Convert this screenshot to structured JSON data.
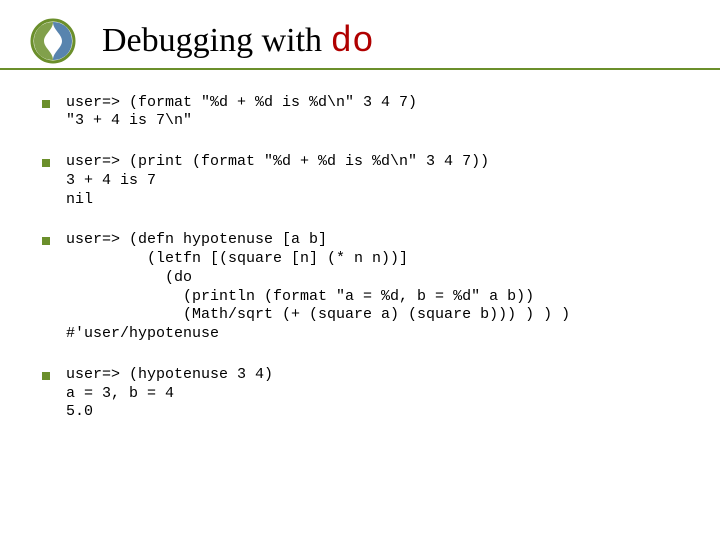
{
  "title_prefix": "Debugging with ",
  "title_keyword": "do",
  "bullets": [
    "user=> (format \"%d + %d is %d\\n\" 3 4 7)\n\"3 + 4 is 7\\n\"",
    "user=> (print (format \"%d + %d is %d\\n\" 3 4 7))\n3 + 4 is 7\nnil",
    "user=> (defn hypotenuse [a b]\n         (letfn [(square [n] (* n n))]\n           (do\n             (println (format \"a = %d, b = %d\" a b))\n             (Math/sqrt (+ (square a) (square b))) ) ) )\n#'user/hypotenuse",
    "user=> (hypotenuse 3 4)\na = 3, b = 4\n5.0"
  ]
}
